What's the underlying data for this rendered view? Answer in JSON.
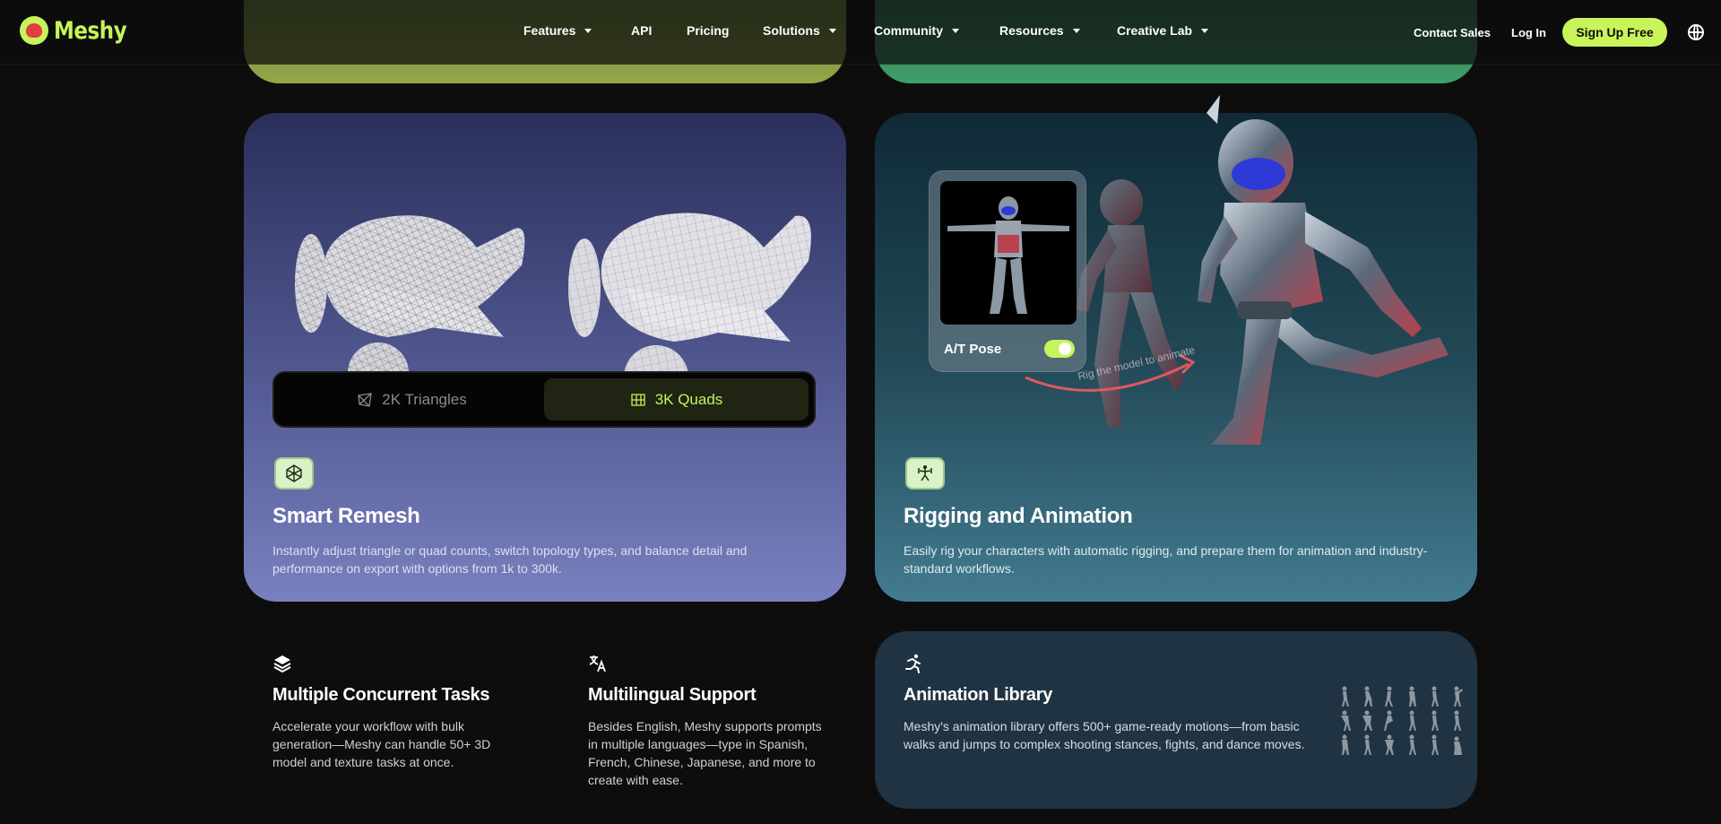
{
  "brand": {
    "name": "Meshy"
  },
  "nav": {
    "menu": [
      {
        "label": "Features",
        "has_dropdown": true
      },
      {
        "label": "API",
        "has_dropdown": false
      },
      {
        "label": "Pricing",
        "has_dropdown": false
      },
      {
        "label": "Solutions",
        "has_dropdown": true
      },
      {
        "label": "Community",
        "has_dropdown": true
      },
      {
        "label": "Resources",
        "has_dropdown": true
      },
      {
        "label": "Creative Lab",
        "has_dropdown": true
      }
    ],
    "contact_sales": "Contact Sales",
    "log_in": "Log In",
    "sign_up": "Sign Up Free",
    "language_icon": "globe-icon"
  },
  "remesh": {
    "toggle": {
      "triangles_label": "2K Triangles",
      "quads_label": "3K Quads",
      "selected": "quads"
    },
    "icon": "remesh-icon",
    "title": "Smart Remesh",
    "description": "Instantly adjust triangle or quad counts, switch topology types, and balance detail and performance on export with options from 1k to 300k."
  },
  "rigging": {
    "pose_toggle_label": "A/T Pose",
    "pose_toggle_on": true,
    "arrow_text": "Rig the model to animate",
    "icon": "rigging-icon",
    "title": "Rigging and Animation",
    "description": "Easily rig your characters with automatic rigging, and prepare them for animation and industry-standard workflows."
  },
  "features": [
    {
      "icon": "layers-icon",
      "title": "Multiple Concurrent Tasks",
      "description": "Accelerate your workflow with bulk generation—Meshy can handle 50+ 3D model and texture tasks at once."
    },
    {
      "icon": "translate-icon",
      "title": "Multilingual Support",
      "description": "Besides English, Meshy supports prompts in multiple languages—type in Spanish, French, Chinese, Japanese, and more to create with ease."
    }
  ],
  "animation_library": {
    "icon": "running-icon",
    "title": "Animation Library",
    "description": "Meshy's animation library offers 500+ game-ready motions—from basic walks and jumps to complex shooting stances, fights, and dance moves."
  },
  "colors": {
    "accent": "#c6f45a",
    "background": "#0d0d0d"
  }
}
